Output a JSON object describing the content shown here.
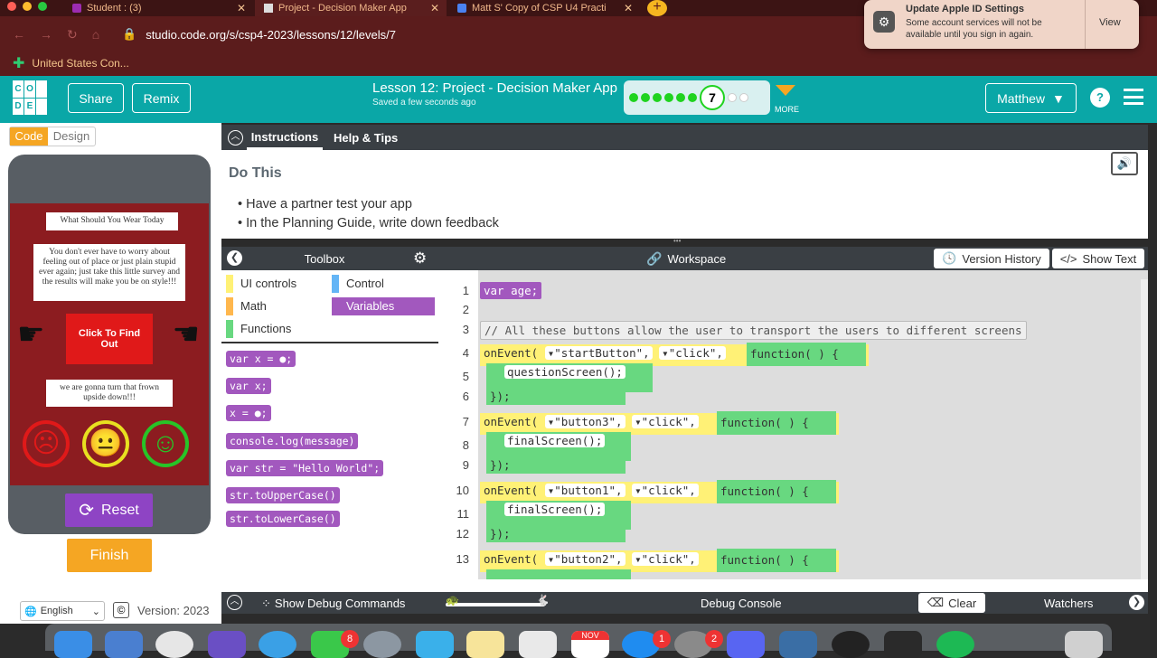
{
  "browser": {
    "tabs": [
      {
        "title": "Student : (3)"
      },
      {
        "title": "Project - Decision Maker App"
      },
      {
        "title": "Matt S' Copy of CSP U4 Practi"
      }
    ],
    "url": "studio.code.org/s/csp4-2023/lessons/12/levels/7",
    "bookmark": "United States Con..."
  },
  "notification": {
    "title": "Update Apple ID Settings",
    "body": "Some account services will not be available until you sign in again.",
    "action": "View"
  },
  "header": {
    "share": "Share",
    "remix": "Remix",
    "lesson_title": "Lesson 12: Project - Decision Maker App",
    "saved": "Saved a few seconds ago",
    "level_number": "7",
    "more": "MORE",
    "user": "Matthew",
    "logo_letters": [
      "C",
      "O",
      "",
      "D",
      "E",
      ""
    ]
  },
  "mode": {
    "code": "Code",
    "design": "Design"
  },
  "app_preview": {
    "title": "What Should You Wear Today",
    "description": "You don't ever have to worry about feeling out of place or just plain stupid ever again; just take this little survey and the results will make you be on style!!!",
    "button": "Click To Find Out",
    "footer_text": "we are gonna turn that frown upside down!!!"
  },
  "controls": {
    "reset": "Reset",
    "finish": "Finish"
  },
  "instructions": {
    "tab_instructions": "Instructions",
    "tab_help": "Help & Tips",
    "heading": "Do This",
    "bullets": [
      "Have a partner test your app",
      "In the Planning Guide, write down feedback"
    ]
  },
  "toolbox": {
    "title": "Toolbox",
    "categories": [
      {
        "label": "UI controls",
        "color": "#fff176"
      },
      {
        "label": "Control",
        "color": "#64b5f6"
      },
      {
        "label": "Math",
        "color": "#ffb74d"
      },
      {
        "label": "Variables",
        "color": "#a258be"
      },
      {
        "label": "Functions",
        "color": "#68d880"
      }
    ],
    "blocks": [
      "var x = ●;",
      "var x;",
      "x = ●;",
      "console.log(message)",
      "var str = \"Hello World\";",
      "str.toUpperCase()",
      "str.toLowerCase()"
    ]
  },
  "workspace": {
    "title": "Workspace",
    "version_history": "Version History",
    "show_text": "Show Text",
    "line_numbers": [
      "1",
      "2",
      "3",
      "4",
      "5",
      "6",
      "7",
      "8",
      "9",
      "10",
      "11",
      "12",
      "13"
    ],
    "code": {
      "l1": "var age;",
      "l3": "// All these buttons allow the user to transport the users to different screens",
      "l4_a": "onEvent(",
      "l4_b": "\"startButton\",",
      "l4_c": "\"click\",",
      "fn": "function(  ) {",
      "l5": "questionScreen();",
      "close": "});",
      "l7_b": "\"button3\",",
      "l8": "finalScreen();",
      "l10_b": "\"button1\",",
      "l11": "finalScreen();",
      "l13_b": "\"button2\","
    }
  },
  "bottom": {
    "language": "English",
    "version": "Version: 2023",
    "show_debug": "Show Debug Commands",
    "debug_console": "Debug Console",
    "clear": "Clear",
    "watchers": "Watchers"
  },
  "dock": {
    "badges": [
      "8",
      "1",
      "2"
    ],
    "calendar_month": "NOV"
  }
}
